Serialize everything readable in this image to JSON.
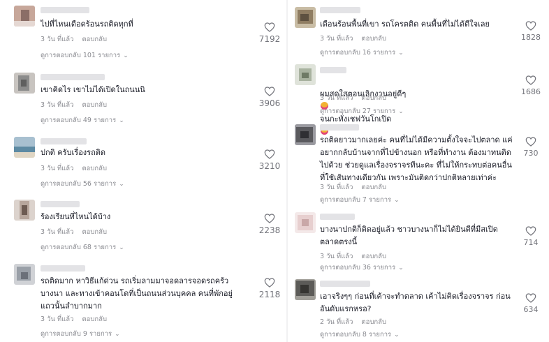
{
  "comments_left": [
    {
      "text": "ไปที่ไหนเดือดร้อนรถติดทุกที่",
      "time": "3 วัน ที่แล้ว",
      "reply": "ตอบกลับ",
      "replies": "ดูการตอบกลับ 101 รายการ",
      "likes": "7192",
      "avatar_colors": [
        "#c7a79a",
        "#8b6e67",
        "#e5d8d3"
      ]
    },
    {
      "text": "เขาคิดไร เขาไม่ได้เปิดในถนนนิ",
      "time": "3 วัน ที่แล้ว",
      "reply": "ตอบกลับ",
      "replies": "ดูการตอบกลับ 49 รายการ",
      "likes": "3906",
      "avatar_colors": [
        "#8c8c8c",
        "#5f5f5f",
        "#c8c4c0"
      ]
    },
    {
      "text": "ปกติ ครับเรื่องรถติด",
      "time": "3 วัน ที่แล้ว",
      "reply": "ตอบกลับ",
      "replies": "ดูการตอบกลับ 56 รายการ",
      "likes": "3210",
      "avatar_colors": [
        "#a8c0d0",
        "#5d8aa3",
        "#e0d6c4"
      ]
    },
    {
      "text": "ร้องเรียนที่ไหนได้บ้าง",
      "time": "3 วัน ที่แล้ว",
      "reply": "ตอบกลับ",
      "replies": "ดูการตอบกลับ 68 รายการ",
      "likes": "2238",
      "avatar_colors": [
        "#b7a69c",
        "#6d5b52",
        "#dcd3cd"
      ]
    },
    {
      "text": "รถติดมาก หาวิธีแก้ด่วน รถเริ่มลามมาจอดลารจอดรถครัว\nบางนา และทางเข้าคอนโดที่เป็นถนนส่วนบุคคล คนที่พักอยู่\nแถวนั้นลำบากมาก",
      "time": "3 วัน ที่แล้ว",
      "reply": "ตอบกลับ",
      "replies": "ดูการตอบกลับ 9 รายการ",
      "likes": "2118",
      "avatar_colors": [
        "#9aa0a8",
        "#6b7079",
        "#d0d2d6"
      ]
    }
  ],
  "comments_right": [
    {
      "text": "เดือนร้อนพื้นที่เขา รถโครตติด คนพื้นที่ไม่ได้ดีใจเลย",
      "time": "3 วัน ที่แล้ว",
      "reply": "ตอบกลับ",
      "replies": "ดูการตอบกลับ 16 รายการ",
      "likes": "1828",
      "avatar_colors": [
        "#8f7d62",
        "#5e5140",
        "#c9bda5"
      ]
    },
    {
      "text": "ผมสดใสตอนเลิกงานอยู่ดีๆ",
      "text_after": "จนกะทั่งเชฟวันโกเปิด",
      "time": "3 วัน ที่แล้ว",
      "reply": "ตอบกลับ",
      "replies": "ดูการตอบกลับ 27 รายการ",
      "likes": "1686",
      "emoji_1": "face-emoji",
      "emoji_2": "face-emoji",
      "avatar_colors": [
        "#a9b3a0",
        "#6e7a65",
        "#dfe3da"
      ]
    },
    {
      "text": "รถติดยาวมากเลยค่ะ คนที่ไม่ได้มีความตั้งใจจะไปตลาด แค่\nอยากกลับบ้านจากที่ไปข้างนอก หรือที่ทำงาน ต้องมาทนติด\nไปด้วย ช่วยดูแลเรื่องจราจรทีนะคะ ที่ไม่ให้กระทบต่อคนอื่น\nที่ใช้เส้นทางเดียวกัน เพราะมันติดกว่าปกติหลายเท่าค่ะ",
      "time": "3 วัน ที่แล้ว",
      "reply": "ตอบกลับ",
      "replies": "ดูการตอบกลับ 7 รายการ",
      "likes": "730",
      "avatar_colors": [
        "#5a5a5e",
        "#2f2f33",
        "#9a9aa0"
      ]
    },
    {
      "text": "บางนาปกติก็ติดอยู่แล้ว ชาวบางนาก็ไม่ได้ยินดีที่มีสเปิด\nตลาดตรงนี้",
      "time": "3 วัน ที่แล้ว",
      "reply": "ตอบกลับ",
      "replies": "ดูการตอบกลับ 36 รายการ",
      "likes": "714",
      "avatar_colors": [
        "#e7cfcf",
        "#c9a7a7",
        "#f4e9e9"
      ]
    },
    {
      "text": "เอาจริงๆๆ ก่อนที่เค้าจะทำตลาด เค้าไม่คิดเรื่องจราจร ก่อน\nอันดับแรกหรอ?",
      "time": "2 วัน ที่แล้ว",
      "reply": "ตอบกลับ",
      "replies": "ดูการตอบกลับ 8 รายการ",
      "likes": "634",
      "avatar_colors": [
        "#5c5b58",
        "#363532",
        "#a09e98"
      ]
    }
  ],
  "colors": {
    "text": "#161823",
    "muted": "#8a8b91",
    "heart": "#73747b",
    "emoji": "#f2b233"
  },
  "icons": {
    "like": "heart-outline-icon",
    "expand": "chevron-down-icon"
  }
}
